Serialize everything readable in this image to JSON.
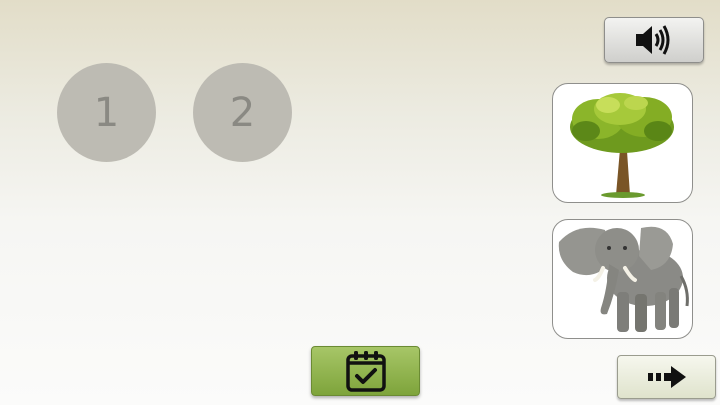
{
  "slots": [
    {
      "label": "1"
    },
    {
      "label": "2"
    }
  ],
  "buttons": {
    "sound_icon": "speaker-icon",
    "check_icon": "calendar-check-icon",
    "next_icon": "dotted-arrow-right-icon"
  },
  "cards": [
    {
      "picture": "tree"
    },
    {
      "picture": "elephant"
    }
  ],
  "colors": {
    "slot_fill": "#bdbbb3",
    "check_green": "#8fb24b",
    "card_border": "#8f8f8c"
  }
}
